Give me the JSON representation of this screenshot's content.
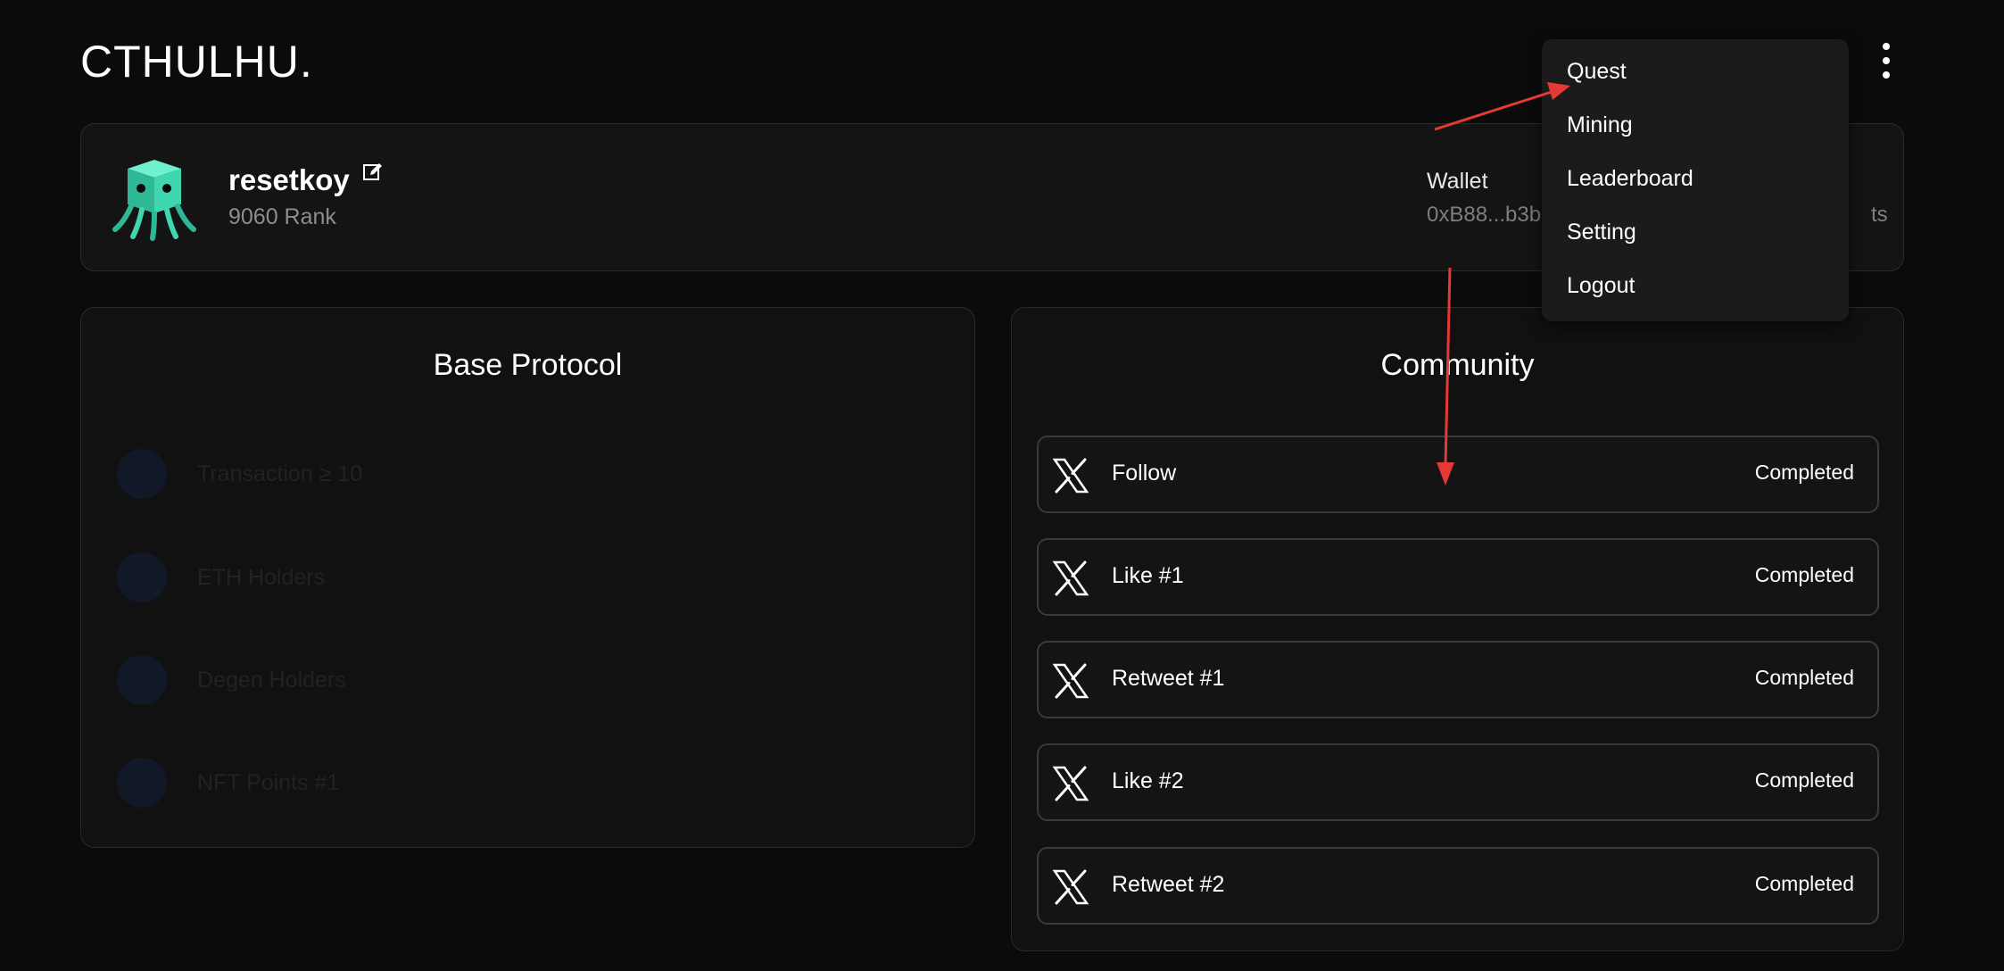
{
  "header": {
    "logo": "CTHULHU."
  },
  "profile": {
    "username": "resetkoy",
    "rank": "9060 Rank",
    "wallet_label": "Wallet",
    "wallet_value": "0xB88...b3b",
    "points_fragment": "ts"
  },
  "base_protocol": {
    "title": "Base Protocol",
    "items": [
      {
        "label": "Transaction ≥ 10"
      },
      {
        "label": "ETH Holders"
      },
      {
        "label": "Degen Holders"
      },
      {
        "label": "NFT Points #1"
      }
    ]
  },
  "community": {
    "title": "Community",
    "tasks": [
      {
        "label": "Follow",
        "status": "Completed",
        "icon": "x-logo-icon"
      },
      {
        "label": "Like #1",
        "status": "Completed",
        "icon": "x-logo-icon"
      },
      {
        "label": "Retweet #1",
        "status": "Completed",
        "icon": "x-logo-icon"
      },
      {
        "label": "Like #2",
        "status": "Completed",
        "icon": "x-logo-icon"
      },
      {
        "label": "Retweet #2",
        "status": "Completed",
        "icon": "x-logo-icon"
      }
    ]
  },
  "menu": {
    "items": [
      {
        "label": "Quest"
      },
      {
        "label": "Mining"
      },
      {
        "label": "Leaderboard"
      },
      {
        "label": "Setting"
      },
      {
        "label": "Logout"
      }
    ]
  },
  "colors": {
    "background": "#0b0b0b",
    "card": "#141414",
    "border": "#2a2a2a",
    "avatar_teal": "#3fd6b0",
    "annotation_red": "#e53935"
  }
}
